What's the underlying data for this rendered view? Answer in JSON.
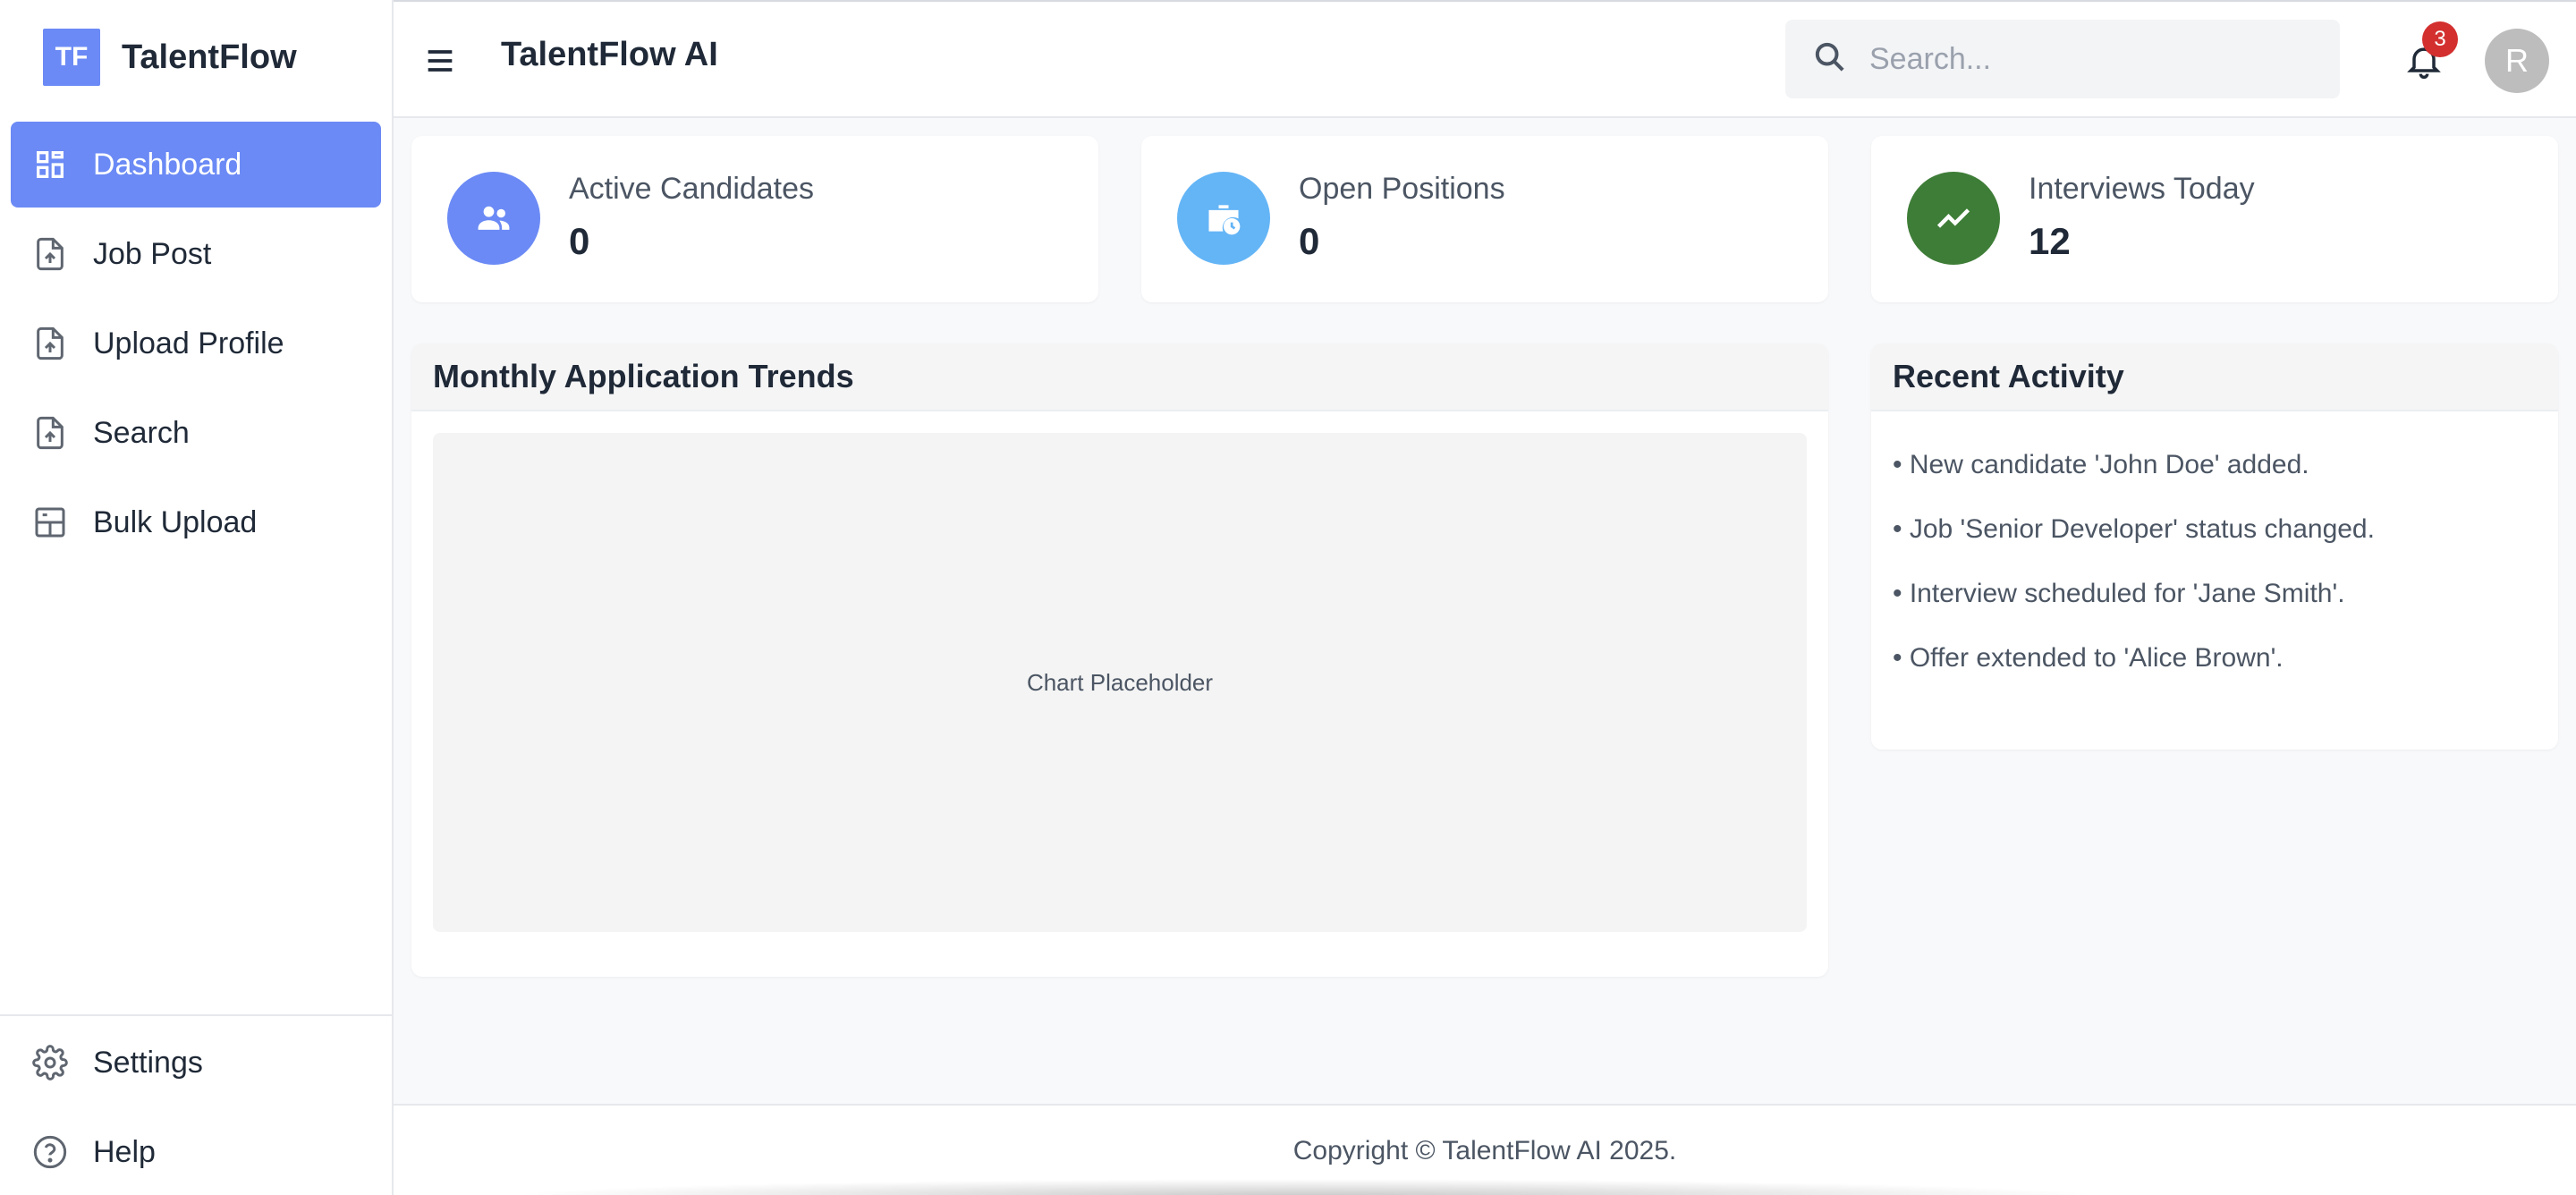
{
  "brand": {
    "logo_text": "TF",
    "name": "TalentFlow"
  },
  "sidebar": {
    "items": [
      {
        "label": "Dashboard",
        "icon": "dashboard-icon",
        "active": true
      },
      {
        "label": "Job Post",
        "icon": "file-upload-icon"
      },
      {
        "label": "Upload Profile",
        "icon": "file-upload-icon"
      },
      {
        "label": "Search",
        "icon": "file-upload-icon"
      },
      {
        "label": "Bulk Upload",
        "icon": "layout-icon"
      }
    ],
    "bottom": [
      {
        "label": "Settings",
        "icon": "gear-icon"
      },
      {
        "label": "Help",
        "icon": "help-icon"
      }
    ]
  },
  "header": {
    "title": "TalentFlow AI",
    "search_placeholder": "Search...",
    "notifications_count": "3",
    "avatar_initial": "R"
  },
  "stats": [
    {
      "label": "Active Candidates",
      "value": "0",
      "icon": "people-icon",
      "color": "#6b8af5"
    },
    {
      "label": "Open Positions",
      "value": "0",
      "icon": "briefcase-clock-icon",
      "color": "#64b5f6"
    },
    {
      "label": "Interviews Today",
      "value": "12",
      "icon": "trending-up-icon",
      "color": "#3e7d37"
    }
  ],
  "trends": {
    "title": "Monthly Application Trends",
    "placeholder": "Chart Placeholder"
  },
  "activity": {
    "title": "Recent Activity",
    "items": [
      "New candidate 'John Doe' added.",
      "Job 'Senior Developer' status changed.",
      "Interview scheduled for 'Jane Smith'.",
      "Offer extended to 'Alice Brown'."
    ]
  },
  "footer": {
    "text": "Copyright © TalentFlow AI 2025."
  },
  "colors": {
    "accent": "#6b8af5",
    "badge": "#d32f2f"
  }
}
